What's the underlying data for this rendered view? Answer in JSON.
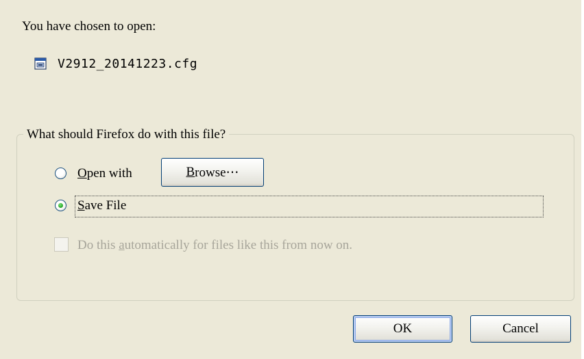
{
  "dialog": {
    "heading": "You have chosen to open:",
    "file_icon": "document-icon",
    "file_name": "V2912_20141223.cfg"
  },
  "group": {
    "title": "What should Firefox do with this file?",
    "open_with": {
      "label_mnemonic": "O",
      "label_rest": "pen with",
      "selected": false
    },
    "browse_button": {
      "label_mnemonic": "B",
      "label_rest": "rowse⋯"
    },
    "save_file": {
      "label_mnemonic": "S",
      "label_rest": "ave File",
      "selected": true
    },
    "auto_checkbox": {
      "label_before": "Do this ",
      "label_mnemonic": "a",
      "label_after": "utomatically for files like this from now on.",
      "checked": false,
      "enabled": false
    }
  },
  "buttons": {
    "ok": "OK",
    "cancel": "Cancel"
  },
  "colors": {
    "dialog_background": "#ece9d8",
    "radio_dot": "#21a121",
    "disabled_text": "#a7a59a",
    "button_border": "#003c74"
  }
}
